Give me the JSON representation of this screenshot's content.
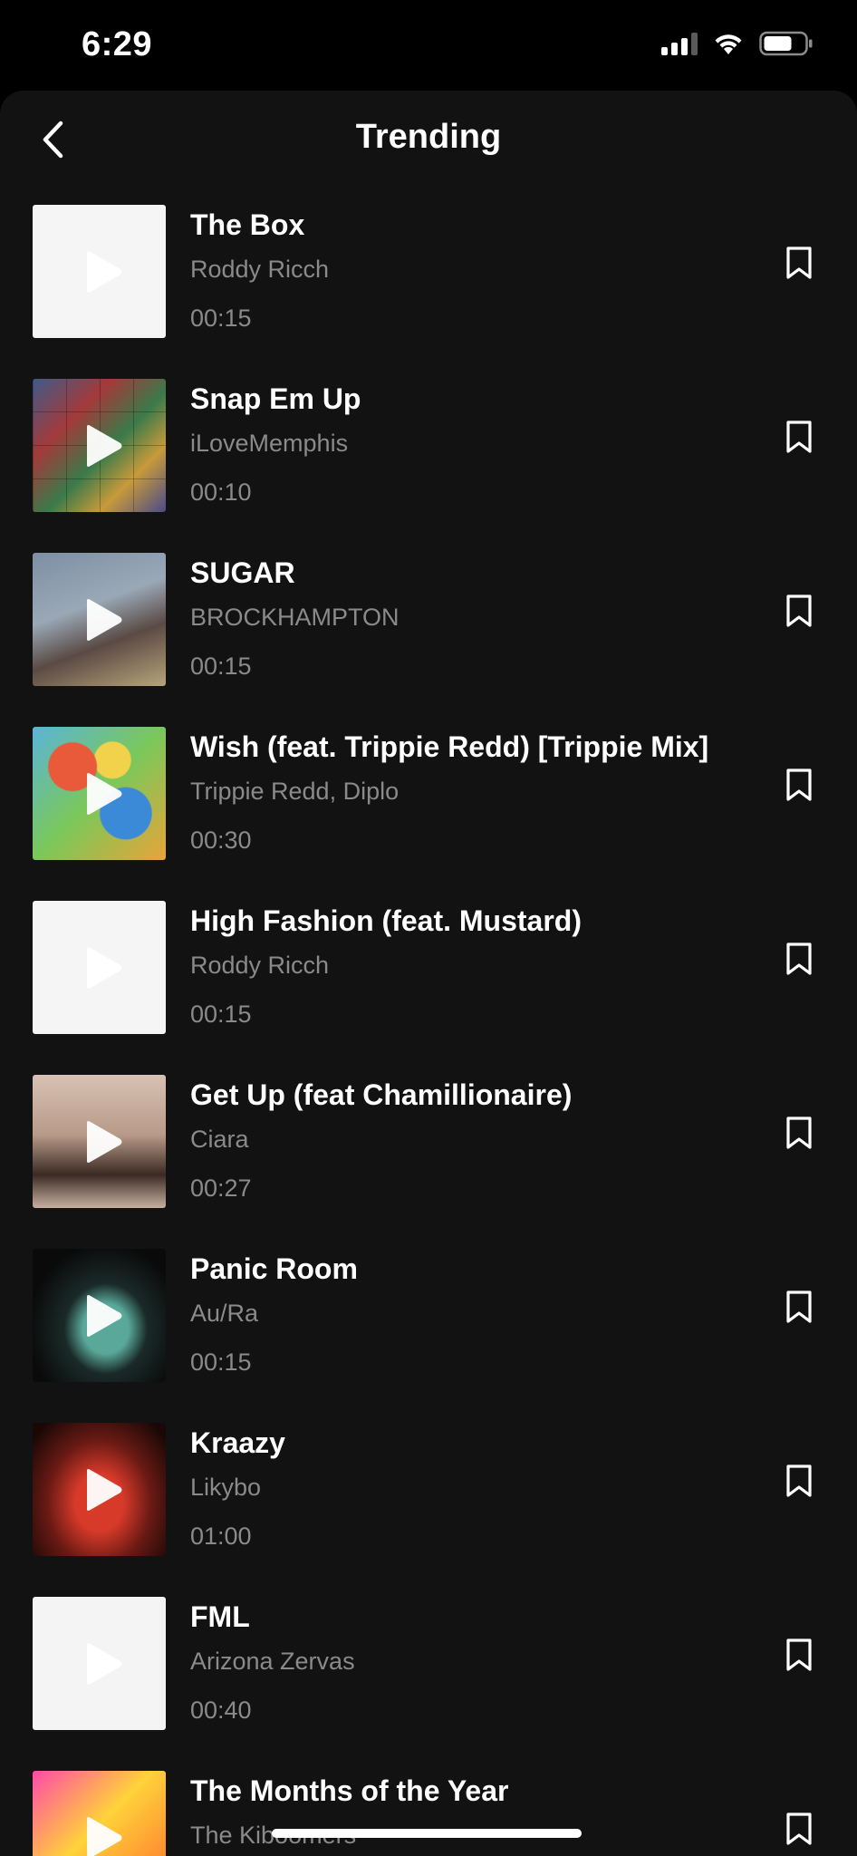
{
  "status_bar": {
    "time": "6:29"
  },
  "header": {
    "title": "Trending"
  },
  "tracks": [
    {
      "title": "The Box",
      "artist": "Roddy Ricch",
      "duration": "00:15",
      "cover": "c-white"
    },
    {
      "title": "Snap Em Up",
      "artist": "iLoveMemphis",
      "duration": "00:10",
      "cover": "c-collage"
    },
    {
      "title": "SUGAR",
      "artist": "BROCKHAMPTON",
      "duration": "00:15",
      "cover": "c-sugar"
    },
    {
      "title": "Wish (feat. Trippie Redd) [Trippie Mix]",
      "artist": "Trippie Redd, Diplo",
      "duration": "00:30",
      "cover": "c-wish"
    },
    {
      "title": "High Fashion (feat. Mustard)",
      "artist": "Roddy Ricch",
      "duration": "00:15",
      "cover": "c-white"
    },
    {
      "title": "Get Up (feat Chamillionaire)",
      "artist": "Ciara",
      "duration": "00:27",
      "cover": "c-ciara"
    },
    {
      "title": "Panic Room",
      "artist": "Au/Ra",
      "duration": "00:15",
      "cover": "c-panic"
    },
    {
      "title": "Kraazy",
      "artist": "Likybo",
      "duration": "01:00",
      "cover": "c-kraazy"
    },
    {
      "title": "FML",
      "artist": "Arizona Zervas",
      "duration": "00:40",
      "cover": "c-fml"
    },
    {
      "title": "The Months of the Year",
      "artist": "The Kiboomers",
      "duration": "",
      "cover": "c-months"
    }
  ],
  "icons": {
    "back": "chevron-left-icon",
    "play": "play-icon",
    "bookmark": "bookmark-icon",
    "signal": "cellular-signal-icon",
    "wifi": "wifi-icon",
    "battery": "battery-icon"
  },
  "colors": {
    "sheet_background": "#121212",
    "secondary_text": "#8a8a8a"
  }
}
